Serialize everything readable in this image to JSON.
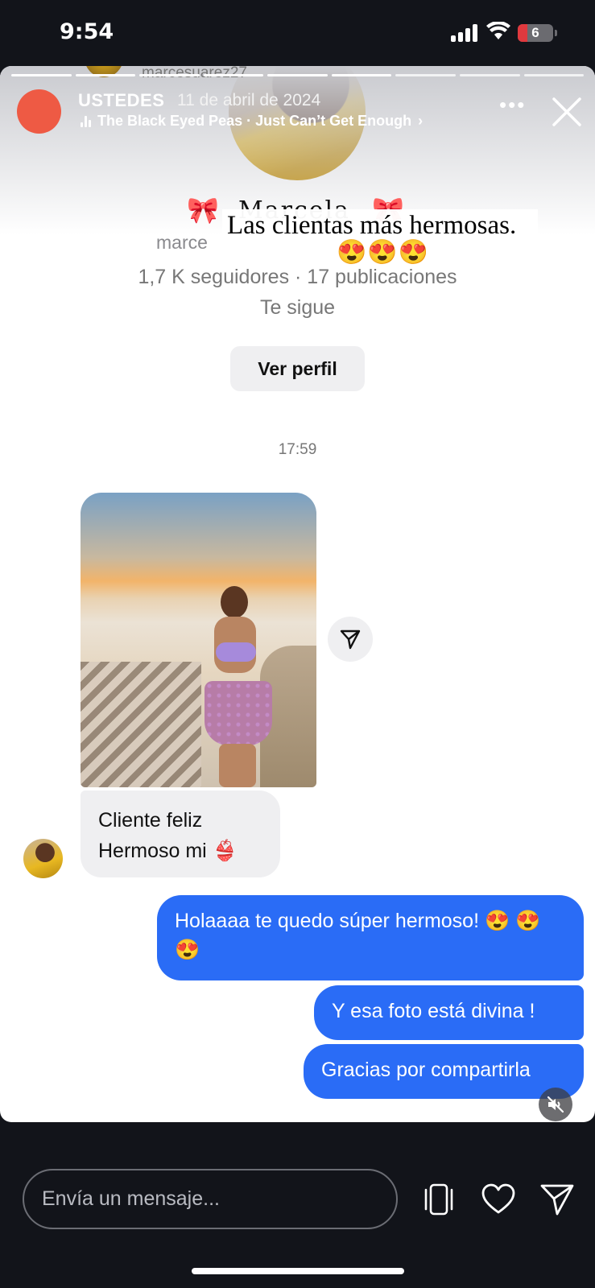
{
  "status_bar": {
    "time": "9:54",
    "battery": "6",
    "icons": [
      "cellular-signal-icon",
      "wifi-icon",
      "battery-icon"
    ]
  },
  "story": {
    "username": "USTEDES",
    "date": "11 de abril de 2024",
    "music": "The Black Eyed Peas · Just Can’t Get Enough",
    "music_chevron": "›",
    "more": "•••",
    "previous_username": "marcesuarez27",
    "overlay_text": "Las clientas más hermosas.",
    "overlay_emojis": "😍😍😍",
    "progress_segments": 9
  },
  "profile": {
    "name": "Marcela",
    "handle": "marce",
    "stats": "1,7 K seguidores · 17 publicaciones",
    "follows": "Te sigue",
    "view_button": "Ver perfil",
    "bow": "🎀"
  },
  "chat": {
    "time": "17:59",
    "incoming_line1": "Cliente feliz",
    "incoming_line2": "Hermoso mi 👙",
    "outgoing": [
      "Holaaaa te quedo súper hermoso! 😍 😍 😍",
      "Y esa foto está divina !",
      "Gracias por compartirla"
    ]
  },
  "reply_bar": {
    "placeholder": "Envía un mensaje..."
  },
  "colors": {
    "accent_blue": "#2a6cf6",
    "background": "#12141a",
    "avatar_red": "#ee5a44"
  }
}
